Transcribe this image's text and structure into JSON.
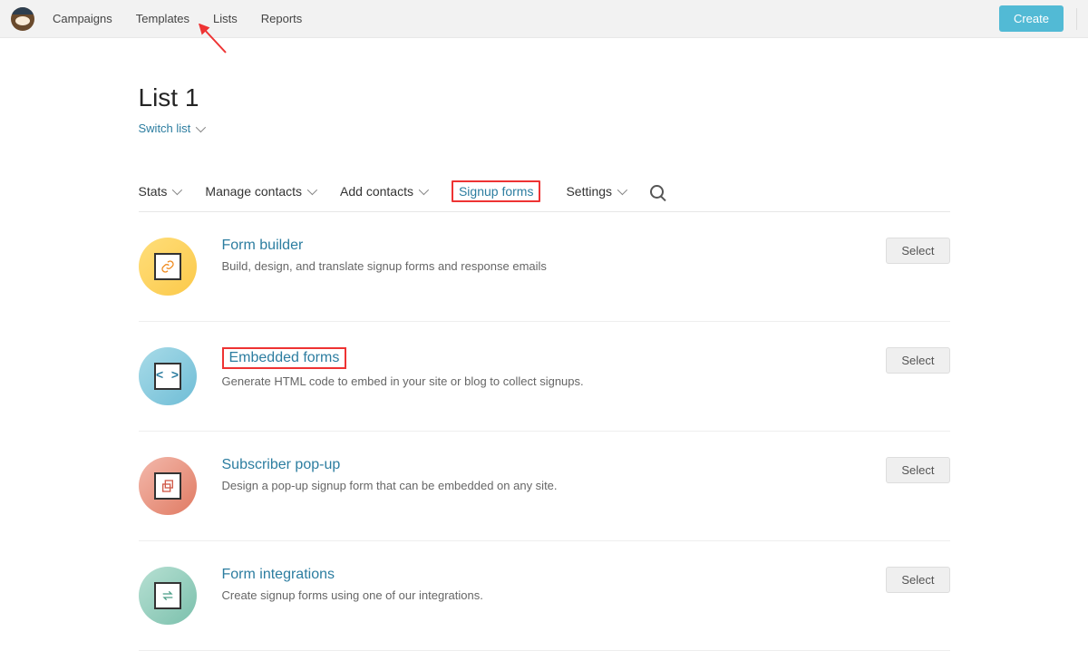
{
  "nav": {
    "items": [
      "Campaigns",
      "Templates",
      "Lists",
      "Reports"
    ],
    "create": "Create"
  },
  "page": {
    "title": "List 1",
    "switch": "Switch list"
  },
  "tabs": {
    "stats": "Stats",
    "manage": "Manage contacts",
    "add": "Add contacts",
    "signup": "Signup forms",
    "settings": "Settings"
  },
  "rows": [
    {
      "title": "Form builder",
      "desc": "Build, design, and translate signup forms and response emails",
      "select": "Select"
    },
    {
      "title": "Embedded forms",
      "desc": "Generate HTML code to embed in your site or blog to collect signups.",
      "select": "Select"
    },
    {
      "title": "Subscriber pop-up",
      "desc": "Design a pop-up signup form that can be embedded on any site.",
      "select": "Select"
    },
    {
      "title": "Form integrations",
      "desc": "Create signup forms using one of our integrations.",
      "select": "Select"
    }
  ]
}
